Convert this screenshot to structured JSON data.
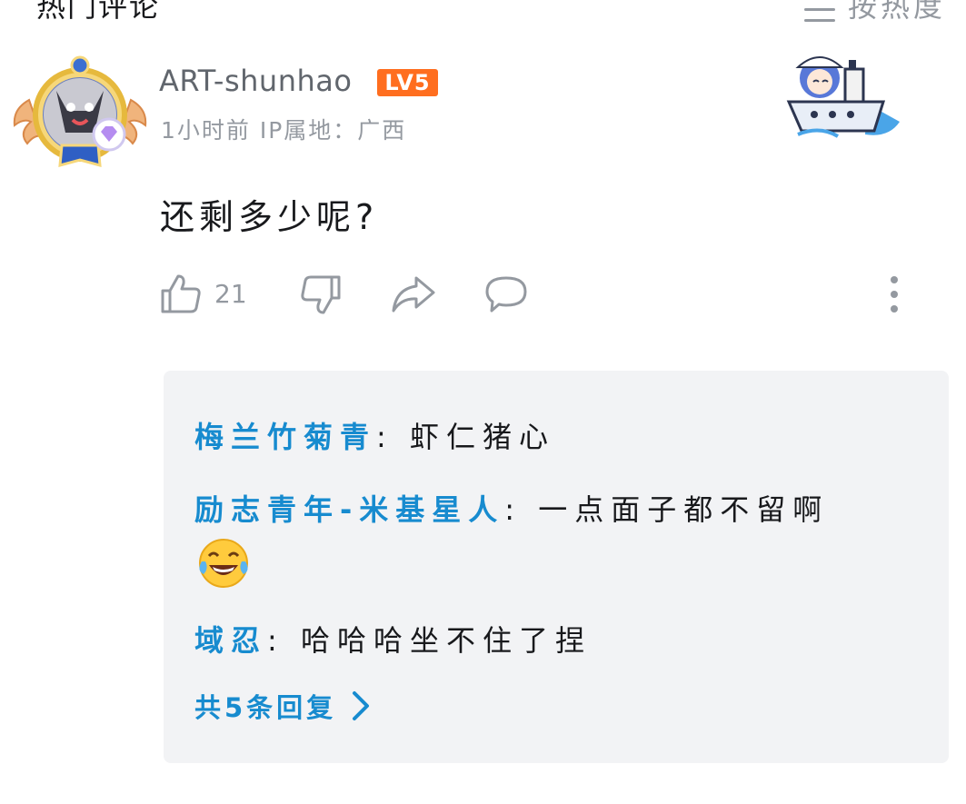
{
  "header": {
    "section_title": "热门评论",
    "sort_label": "按热度"
  },
  "comment": {
    "username": "ART-shunhao",
    "level": "LV5",
    "time": "1小时前",
    "ip_location": "IP属地：广西",
    "text": "还剩多少呢?",
    "like_count": "21"
  },
  "replies": [
    {
      "user": "梅兰竹菊青",
      "separator": ":",
      "text": "虾仁猪心"
    },
    {
      "user": "励志青年-米基星人",
      "separator": ":",
      "text": "一点面子都不留啊"
    },
    {
      "user": "域忍",
      "separator": ":",
      "text": "哈哈哈坐不住了捏"
    }
  ],
  "more_replies_label": "共5条回复",
  "colors": {
    "link_blue": "#178bcf",
    "level_orange": "#ff6e1f",
    "muted_gray": "#9499a0",
    "reply_bg": "#f2f3f5"
  },
  "icons": [
    "menu-icon",
    "like-icon",
    "dislike-icon",
    "share-icon",
    "comment-icon",
    "more-options-icon",
    "chevron-right-icon",
    "laughing-tears-emoji"
  ]
}
